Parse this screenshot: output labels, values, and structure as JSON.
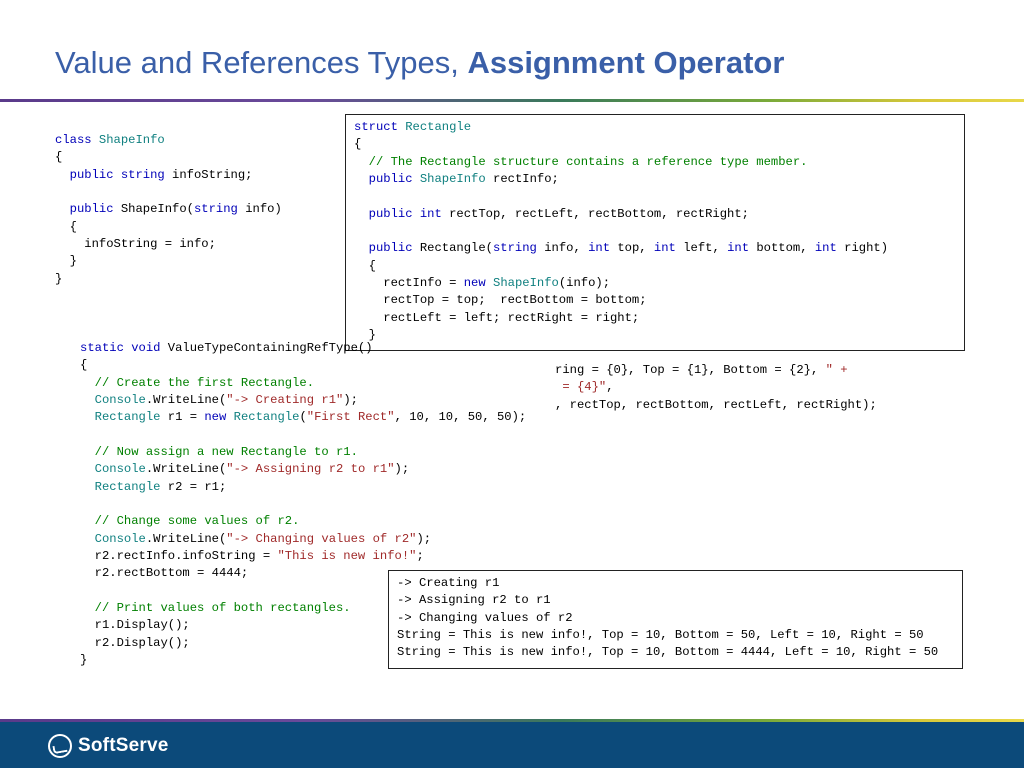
{
  "title": {
    "light": "Value and References Types, ",
    "bold": "Assignment Operator"
  },
  "code": {
    "shapeinfo": "<span class=\"kw\">class</span> <span class=\"type\">ShapeInfo</span>\n{\n  <span class=\"kw\">public string</span> infoString;\n\n  <span class=\"kw\">public</span> ShapeInfo(<span class=\"kw\">string</span> info)\n  {\n    infoString = info;\n  }\n}",
    "rectstruct": "<span class=\"kw\">struct</span> <span class=\"type\">Rectangle</span>\n{\n  <span class=\"com\">// The Rectangle structure contains a reference type member.</span>\n  <span class=\"kw\">public</span> <span class=\"type\">ShapeInfo</span> rectInfo;\n\n  <span class=\"kw\">public int</span> rectTop, rectLeft, rectBottom, rectRight;\n\n  <span class=\"kw\">public</span> Rectangle(<span class=\"kw\">string</span> info, <span class=\"kw\">int</span> top, <span class=\"kw\">int</span> left, <span class=\"kw\">int</span> bottom, <span class=\"kw\">int</span> right)\n  {\n    rectInfo = <span class=\"kw\">new</span> <span class=\"type\">ShapeInfo</span>(info);\n    rectTop = top;  rectBottom = bottom;\n    rectLeft = left; rectRight = right;\n  }",
    "rectextra": "ring = {0}, Top = {1}, Bottom = {2}, <span class=\"str\">\" +</span>\n<span class=\"str\"> = {4}\"</span>,\n, rectTop, rectBottom, rectLeft, rectRight);",
    "mainmethod": "<span class=\"kw\">static void</span> ValueTypeContainingRefType()\n{\n  <span class=\"com\">// Create the first Rectangle.</span>\n  <span class=\"type\">Console</span>.WriteLine(<span class=\"str\">\"-> Creating r1\"</span>);\n  <span class=\"type\">Rectangle</span> r1 = <span class=\"kw\">new</span> <span class=\"type\">Rectangle</span>(<span class=\"str\">\"First Rect\"</span>, 10, 10, 50, 50);\n\n  <span class=\"com\">// Now assign a new Rectangle to r1.</span>\n  <span class=\"type\">Console</span>.WriteLine(<span class=\"str\">\"-> Assigning r2 to r1\"</span>);\n  <span class=\"type\">Rectangle</span> r2 = r1;\n\n  <span class=\"com\">// Change some values of r2.</span>\n  <span class=\"type\">Console</span>.WriteLine(<span class=\"str\">\"-> Changing values of r2\"</span>);\n  r2.rectInfo.infoString = <span class=\"str\">\"This is new info!\"</span>;\n  r2.rectBottom = 4444;\n\n  <span class=\"com\">// Print values of both rectangles.</span>\n  r1.Display();\n  r2.Display();\n}",
    "output": "-> Creating r1\n-> Assigning r2 to r1\n-> Changing values of r2\nString = This is new info!, Top = 10, Bottom = 50, Left = 10, Right = 50\nString = This is new info!, Top = 10, Bottom = 4444, Left = 10, Right = 50"
  },
  "footer": {
    "brand": "SoftServe"
  }
}
